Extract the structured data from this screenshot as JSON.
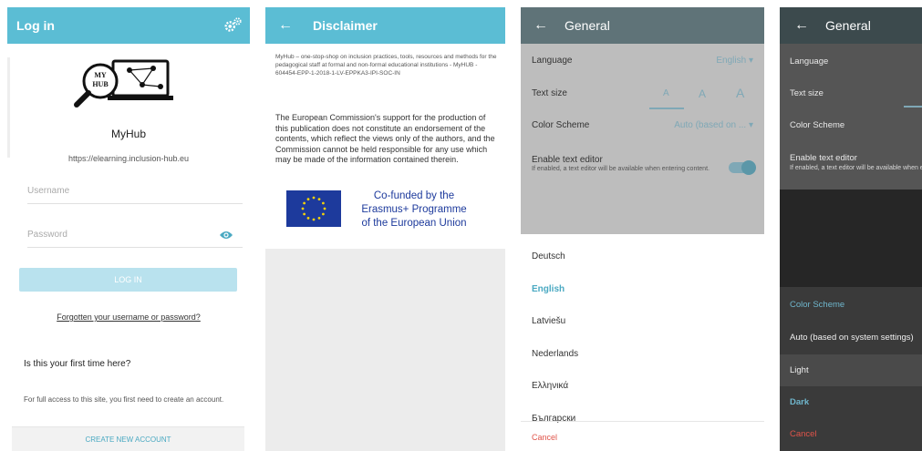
{
  "login": {
    "title": "Log in",
    "logo_text": "MY HUB",
    "app_name": "MyHub",
    "site_url": "https://elearning.inclusion-hub.eu",
    "username_placeholder": "Username",
    "password_placeholder": "Password",
    "login_button": "LOG IN",
    "forgot_link": "Forgotten your username or password?",
    "first_time_heading": "Is this your first time here?",
    "full_access_text": "For full access to this site, you first need to create an account.",
    "create_account_button": "CREATE NEW ACCOUNT",
    "icons": {
      "settings": "gears-icon",
      "show_password": "eye-icon"
    }
  },
  "disclaimer": {
    "title": "Disclaimer",
    "small_text": "MyHub – one-stop-shop on inclusion practices, tools, resources and methods for the pedagogical staff at formal and non-formal educational institutions - MyHUB - 604454-EPP-1-2018-1-LV-EPPKA3-IPI-SOC-IN",
    "body_text": "The European Commission's support for the production of this publication does not constitute an endorsement of the contents, which reflect the views only of the authors, and the Commission cannot be held responsible for any use which may be made of the information contained therein.",
    "eu_line1": "Co-funded by the",
    "eu_line2": "Erasmus+ Programme",
    "eu_line3": "of the European Union"
  },
  "general": {
    "title": "General",
    "language_label": "Language",
    "language_value": "English",
    "text_size_label": "Text size",
    "size_a": "A",
    "color_scheme_label": "Color Scheme",
    "color_scheme_value": "Auto (based on ...",
    "editor_label": "Enable text editor",
    "editor_sub": "If enabled, a text editor will be available when entering content.",
    "editor_enabled": true,
    "languages": [
      "Deutsch",
      "English",
      "Latviešu",
      "Nederlands",
      "Ελληνικά",
      "Български"
    ],
    "selected_language": "English",
    "cancel": "Cancel"
  },
  "general_dark": {
    "title": "General",
    "language_label": "Language",
    "text_size_label": "Text size",
    "color_scheme_label": "Color Scheme",
    "editor_label": "Enable text editor",
    "editor_sub": "If enabled, a text editor will be available when entering content.",
    "dialog_title": "Color Scheme",
    "options": [
      "Auto (based on system settings)",
      "Light",
      "Dark"
    ],
    "selected_option": "Dark",
    "cancel": "Cancel"
  },
  "colors": {
    "teal": "#5bbdd4",
    "header_grey": "#5f7378",
    "accent": "#7fa8b6",
    "cancel_red": "#e0544a",
    "eu_blue": "#1d3a9c"
  }
}
